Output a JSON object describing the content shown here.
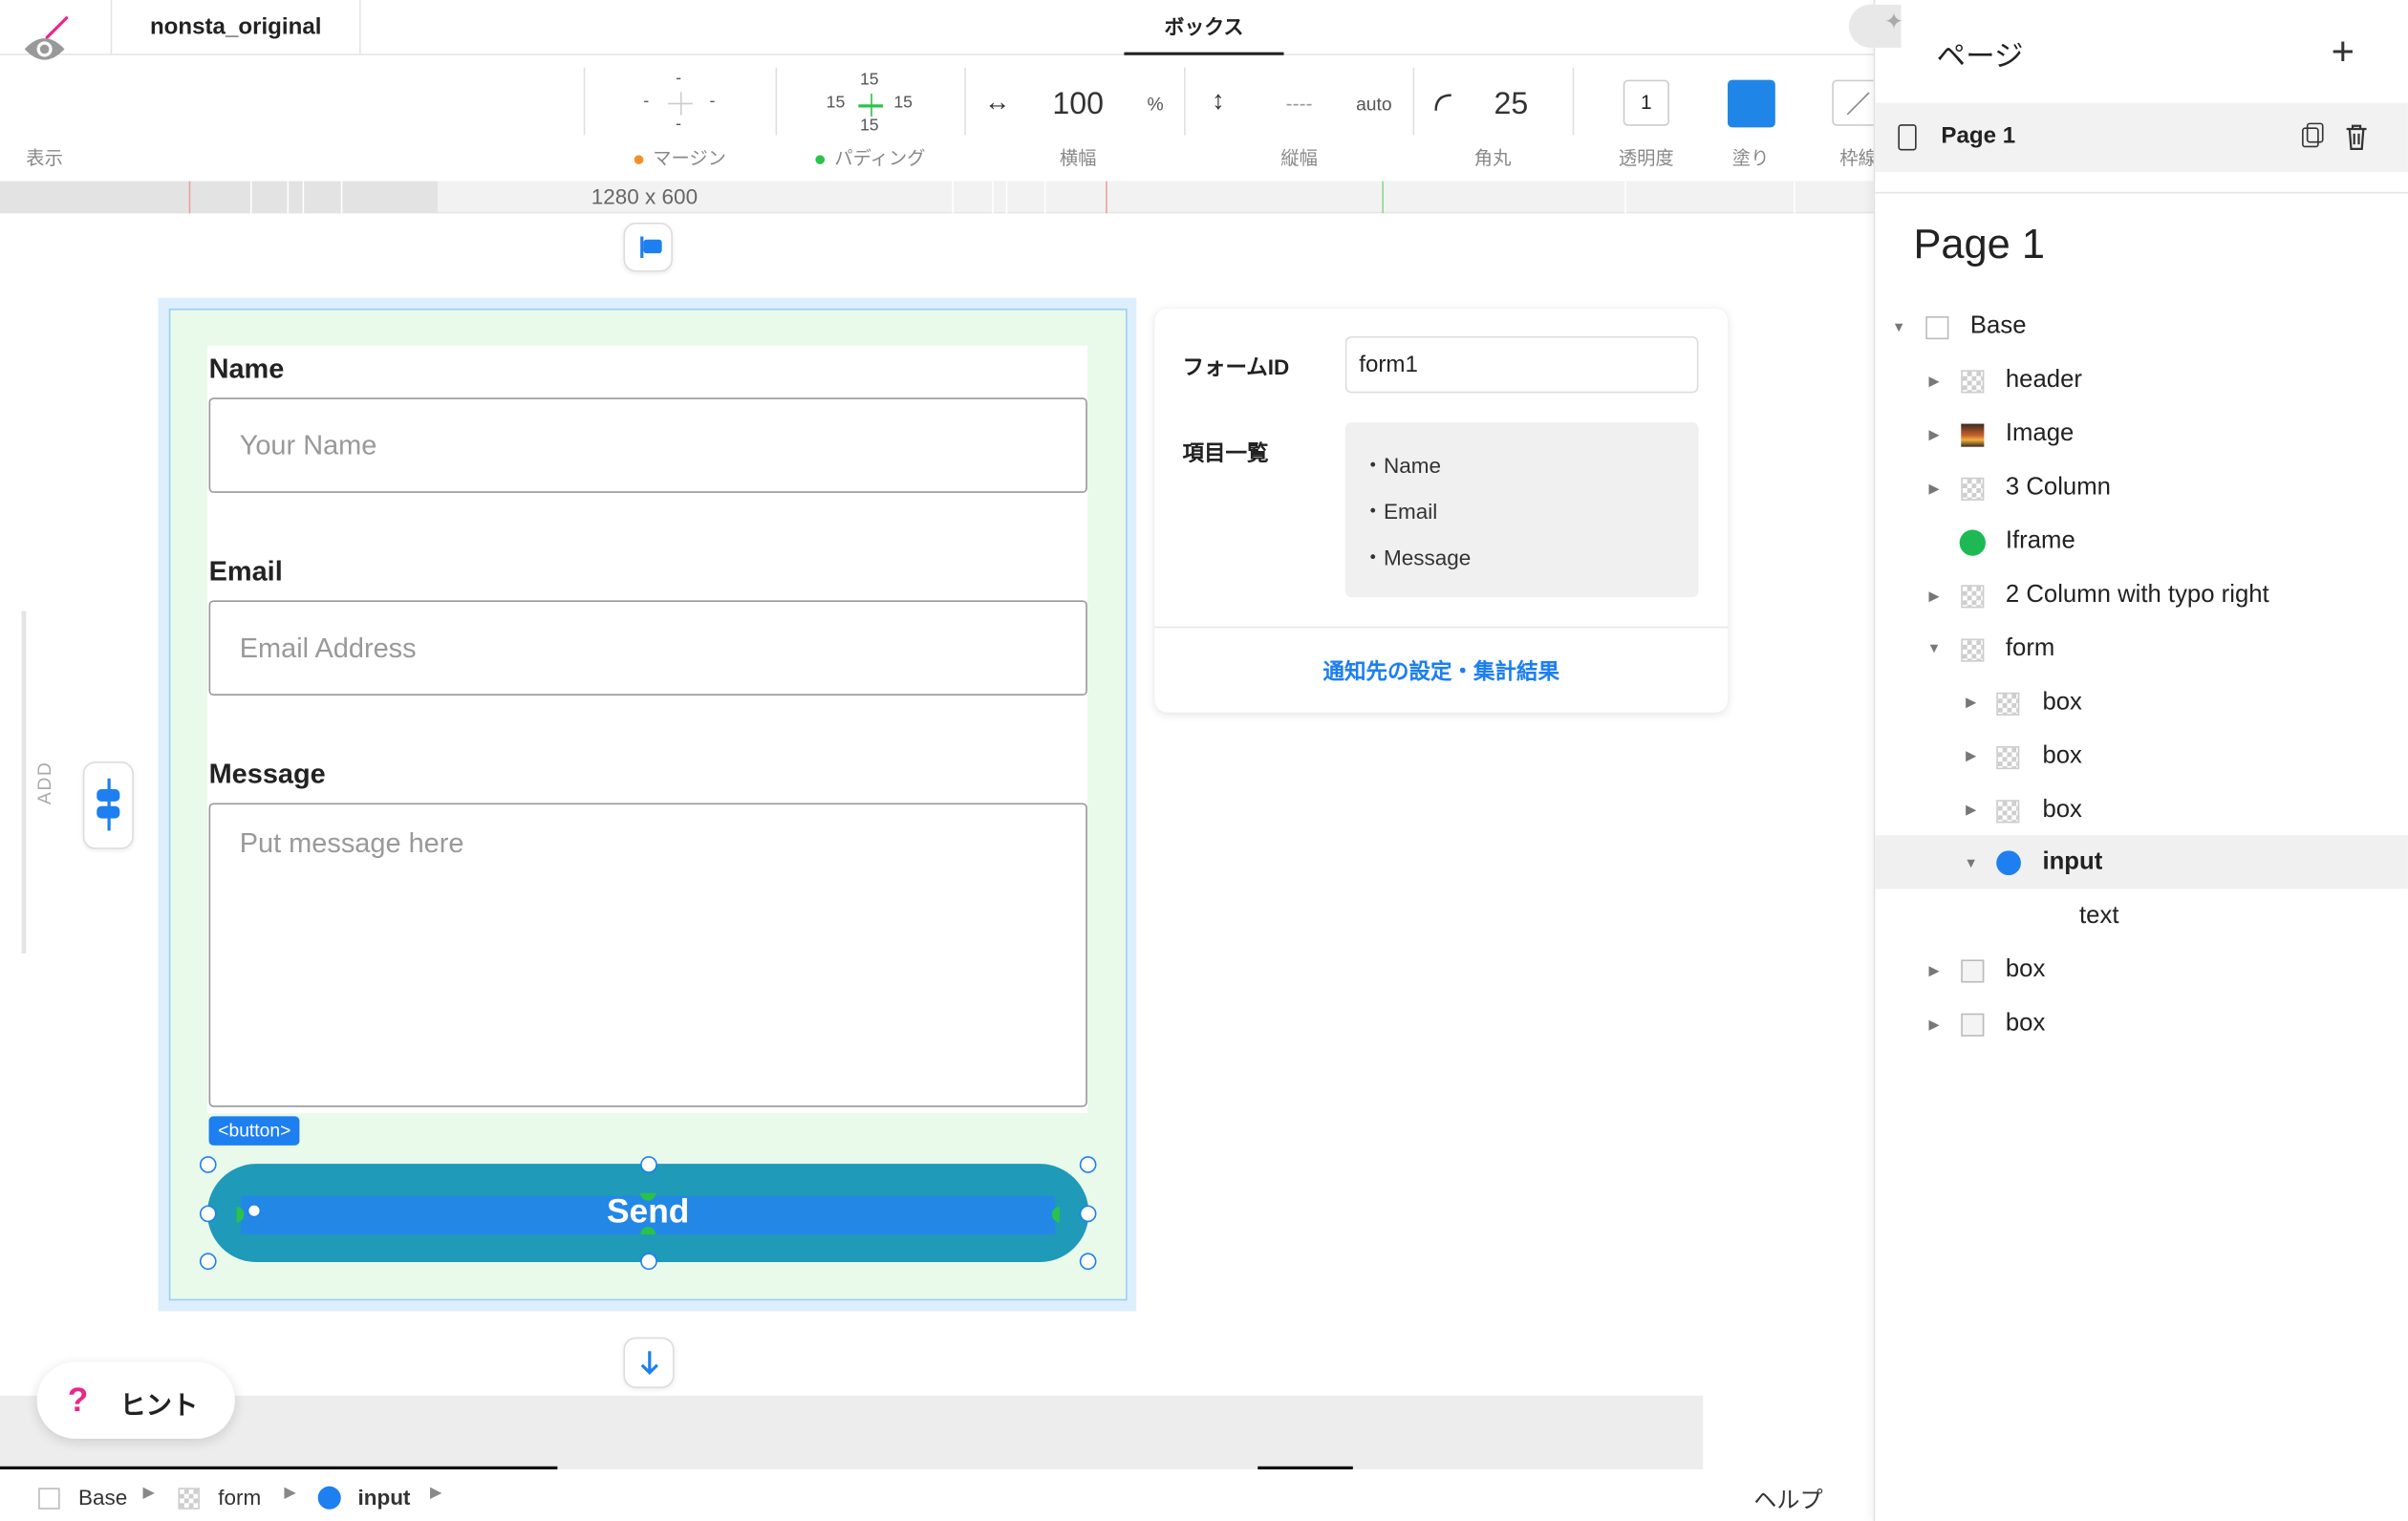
{
  "app": {
    "filename": "nonsta_original",
    "panel_title": "ボックス"
  },
  "toolbar": {
    "view_label": "表示",
    "margin": {
      "top": "-",
      "left": "-",
      "right": "-",
      "bottom": "-",
      "label": "マージン"
    },
    "padding": {
      "top": "15",
      "left": "15",
      "right": "15",
      "bottom": "15",
      "label": "パディング"
    },
    "width": {
      "value": "100",
      "unit": "%",
      "label": "横幅"
    },
    "height": {
      "value": "----",
      "unit": "auto",
      "label": "縦幅"
    },
    "radius": {
      "value": "25",
      "label": "角丸"
    },
    "opacity": {
      "value": "1",
      "label": "透明度"
    },
    "fill": {
      "label": "塗り",
      "color": "#1f86e8"
    },
    "stroke": {
      "label": "枠線"
    }
  },
  "ruler": {
    "size_label": "1280 x 600"
  },
  "canvas": {
    "add_label": "ADD",
    "form": {
      "name_label": "Name",
      "name_placeholder": "Your Name",
      "email_label": "Email",
      "email_placeholder": "Email Address",
      "message_label": "Message",
      "message_placeholder": "Put message here",
      "button_tag": "<button>",
      "send_label": "Send",
      "send_color": "#1f9ab8"
    },
    "form_panel": {
      "form_id_label": "フォームID",
      "form_id_value": "form1",
      "items_label": "項目一覧",
      "items": [
        "・Name",
        "・Email",
        "・Message"
      ],
      "link": "通知先の設定・集計結果"
    },
    "hint": {
      "icon": "?",
      "label": "ヒント"
    }
  },
  "breadcrumb": {
    "items": [
      {
        "label": "Base",
        "icon": "empty-square-icon"
      },
      {
        "label": "form",
        "icon": "checker-icon"
      },
      {
        "label": "input",
        "icon": "blue-dot-icon"
      }
    ],
    "help": "ヘルプ"
  },
  "sidebar": {
    "title": "ページ",
    "add": "+",
    "page_name": "Page 1",
    "heading": "Page 1",
    "tree": [
      {
        "label": "Base",
        "icon": "empty",
        "expanded": true
      },
      {
        "label": "header",
        "icon": "checker",
        "expanded": false
      },
      {
        "label": "Image",
        "icon": "image",
        "expanded": false
      },
      {
        "label": "3 Column",
        "icon": "checker",
        "expanded": false
      },
      {
        "label": "Iframe",
        "icon": "spotify"
      },
      {
        "label": "2 Column with typo right",
        "icon": "checker",
        "expanded": false
      },
      {
        "label": "form",
        "icon": "checker",
        "expanded": true
      },
      {
        "label": "box",
        "icon": "checker",
        "expanded": false
      },
      {
        "label": "box",
        "icon": "checker",
        "expanded": false
      },
      {
        "label": "box",
        "icon": "checker",
        "expanded": false
      },
      {
        "label": "input",
        "icon": "dot",
        "expanded": true,
        "selected": true
      },
      {
        "label": "text"
      },
      {
        "label": "box",
        "icon": "empty",
        "expanded": false
      },
      {
        "label": "box",
        "icon": "empty",
        "expanded": false
      }
    ]
  }
}
